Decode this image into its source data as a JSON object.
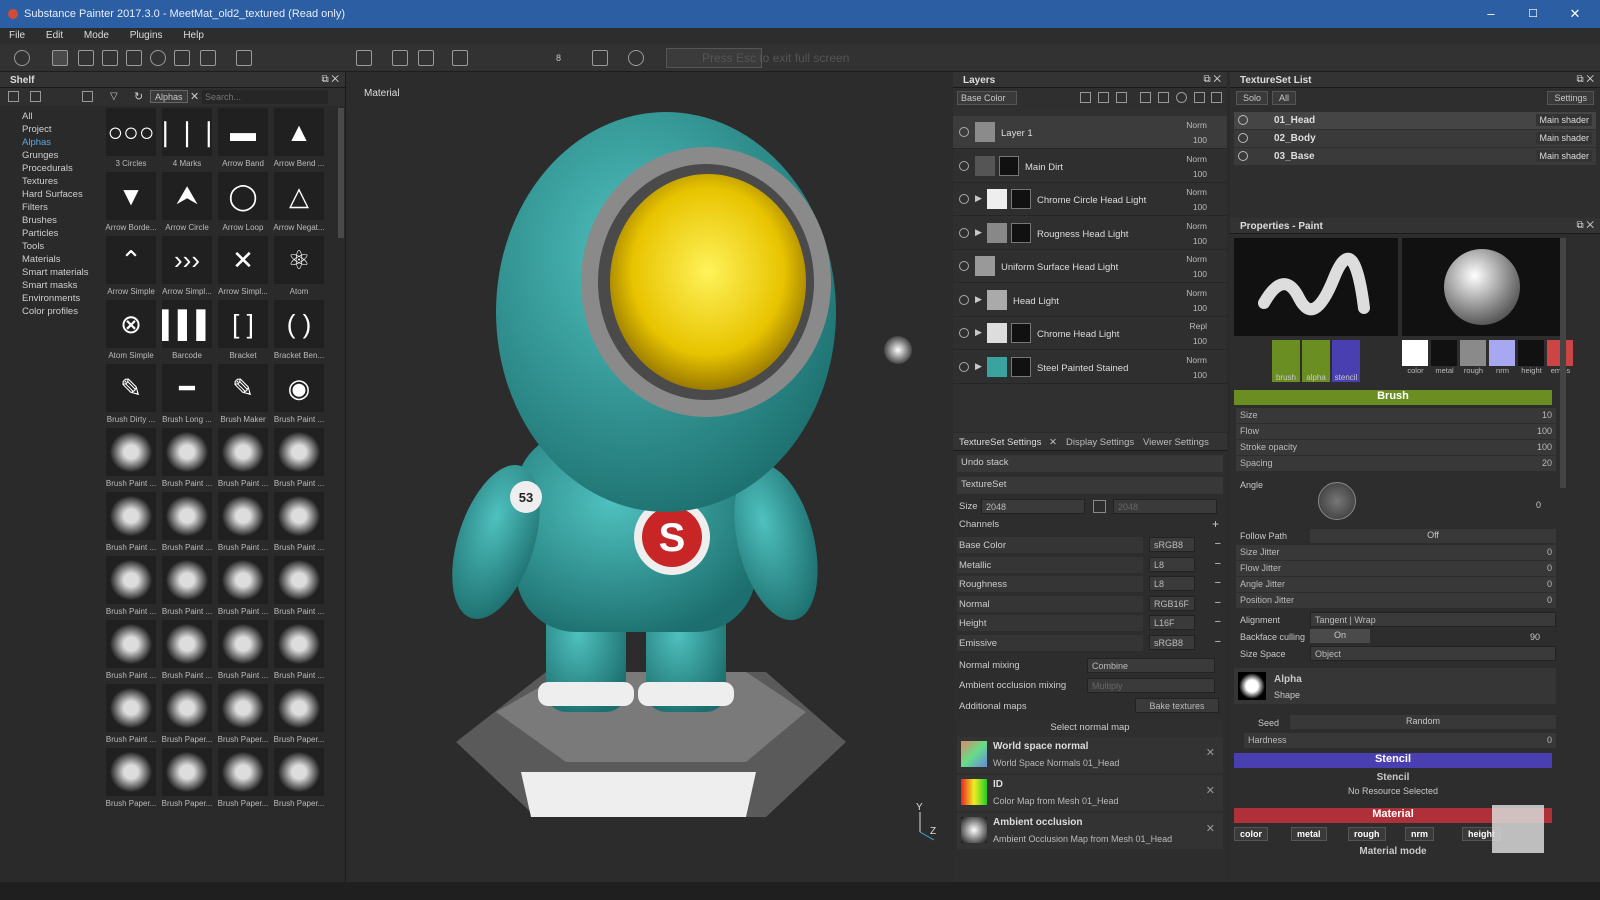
{
  "window": {
    "title": "Substance Painter 2017.3.0 - MeetMat_old2_textured (Read only)",
    "minimize": "–",
    "maximize": "☐",
    "close": "✕"
  },
  "menu": [
    "File",
    "Edit",
    "Mode",
    "Plugins",
    "Help"
  ],
  "toolbar": {
    "fullscreen_hint": "Press Esc to exit full screen",
    "size_value": "8"
  },
  "shelf": {
    "title": "Shelf",
    "filter_tag": "Alphas",
    "search_placeholder": "Search...",
    "categories": [
      "All",
      "Project",
      "Alphas",
      "Grunges",
      "Procedurals",
      "Textures",
      "Hard Surfaces",
      "Filters",
      "Brushes",
      "Particles",
      "Tools",
      "Materials",
      "Smart materials",
      "Smart masks",
      "Environments",
      "Color profiles"
    ],
    "thumbnails": [
      "3 Circles",
      "4 Marks",
      "Arrow Band",
      "Arrow Bend ...",
      "Arrow Borde...",
      "Arrow Circle",
      "Arrow Loop",
      "Arrow Negat...",
      "Arrow Simple",
      "Arrow Simpl...",
      "Arrow Simpl...",
      "Atom",
      "Atom Simple",
      "Barcode",
      "Bracket",
      "Bracket Ben...",
      "Brush Dirty ...",
      "Brush Long ...",
      "Brush Maker",
      "Brush Paint ...",
      "Brush Paint ...",
      "Brush Paint ...",
      "Brush Paint ...",
      "Brush Paint ...",
      "Brush Paint ...",
      "Brush Paint ...",
      "Brush Paint ...",
      "Brush Paint ...",
      "Brush Paint ...",
      "Brush Paint ...",
      "Brush Paint ...",
      "Brush Paint ...",
      "Brush Paint ...",
      "Brush Paint ...",
      "Brush Paint ...",
      "Brush Paint ...",
      "Brush Paint ...",
      "Brush Paper...",
      "Brush Paper...",
      "Brush Paper...",
      "Brush Paper...",
      "Brush Paper...",
      "Brush Paper...",
      "Brush Paper..."
    ]
  },
  "viewport": {
    "label": "Material",
    "axis_y": "Y",
    "axis_z": "Z",
    "badge_number": "53"
  },
  "layers": {
    "title": "Layers",
    "channel": "Base Color",
    "items": [
      {
        "name": "Layer 1",
        "blend": "Norm",
        "opacity": "100",
        "color": "#8b8b8b"
      },
      {
        "name": "Main Dirt",
        "blend": "Norm",
        "opacity": "100",
        "color": "#555555"
      },
      {
        "name": "Chrome Circle Head Light",
        "blend": "Norm",
        "opacity": "100",
        "color": "#eeeeee"
      },
      {
        "name": "Rougness Head Light",
        "blend": "Norm",
        "opacity": "100",
        "color": "#888888"
      },
      {
        "name": "Uniform Surface Head Light",
        "blend": "Norm",
        "opacity": "100",
        "color": "#999999"
      },
      {
        "name": "Head Light",
        "blend": "Norm",
        "opacity": "100",
        "color": "#aaaaaa"
      },
      {
        "name": "Chrome Head Light",
        "blend": "Repl",
        "opacity": "100",
        "color": "#dddddd"
      },
      {
        "name": "Steel Painted Stained",
        "blend": "Norm",
        "opacity": "100",
        "color": "#3aa3a0"
      }
    ]
  },
  "tss": {
    "tabs": [
      "TextureSet Settings",
      "Display Settings",
      "Viewer Settings"
    ],
    "undo": "Undo stack",
    "textureset": "TextureSet",
    "size_label": "Size",
    "size_value": "2048",
    "size_value2": "2048",
    "channels_label": "Channels",
    "channels": [
      {
        "name": "Base Color",
        "format": "sRGB8"
      },
      {
        "name": "Metallic",
        "format": "L8"
      },
      {
        "name": "Roughness",
        "format": "L8"
      },
      {
        "name": "Normal",
        "format": "RGB16F"
      },
      {
        "name": "Height",
        "format": "L16F"
      },
      {
        "name": "Emissive",
        "format": "sRGB8"
      }
    ],
    "normal_mixing_label": "Normal mixing",
    "normal_mixing": "Combine",
    "ao_mixing_label": "Ambient occlusion mixing",
    "ao_mixing": "Multiply",
    "additional_maps": "Additional maps",
    "bake": "Bake textures",
    "select_normal": "Select normal map",
    "maps": [
      {
        "title": "World space normal",
        "sub": "World Space Normals 01_Head"
      },
      {
        "title": "ID",
        "sub": "Color Map from Mesh 01_Head"
      },
      {
        "title": "Ambient occlusion",
        "sub": "Ambient Occlusion Map from Mesh 01_Head"
      }
    ]
  },
  "tslist": {
    "title": "TextureSet List",
    "solo": "Solo",
    "all": "All",
    "settings": "Settings",
    "items": [
      {
        "name": "01_Head",
        "shader": "Main shader"
      },
      {
        "name": "02_Body",
        "shader": "Main shader"
      },
      {
        "name": "03_Base",
        "shader": "Main shader"
      }
    ]
  },
  "props": {
    "title": "Properties - Paint",
    "brush_icons": [
      "brush",
      "alpha",
      "stencil"
    ],
    "mat_icons": [
      "color",
      "metal",
      "rough",
      "nrm",
      "height",
      "emiss"
    ],
    "brush_title": "Brush",
    "size": "Size",
    "size_val": "10",
    "flow": "Flow",
    "flow_val": "100",
    "stroke": "Stroke opacity",
    "stroke_val": "100",
    "spacing": "Spacing",
    "spacing_val": "20",
    "angle": "Angle",
    "angle_val": "0",
    "follow": "Follow Path",
    "follow_val": "Off",
    "size_jitter": "Size Jitter",
    "flow_jitter": "Flow Jitter",
    "angle_jitter": "Angle Jitter",
    "pos_jitter": "Position Jitter",
    "jitter_val": "0",
    "alignment": "Alignment",
    "alignment_val": "Tangent | Wrap",
    "backface": "Backface culling",
    "backface_on": "On",
    "backface_val": "90",
    "size_space": "Size Space",
    "size_space_val": "Object",
    "alpha": "Alpha",
    "shape": "Shape",
    "seed": "Seed",
    "seed_val": "Random",
    "hardness": "Hardness",
    "hardness_val": "0",
    "stencil_title": "Stencil",
    "stencil_label": "Stencil",
    "stencil_none": "No Resource Selected",
    "material_title": "Material",
    "material_mode": "Material mode"
  },
  "colors": {
    "accent": "#5fa6e4",
    "brush_bar": "#6b8e23",
    "stencil_bar": "#4a3fb0",
    "material_bar": "#b0303a"
  }
}
